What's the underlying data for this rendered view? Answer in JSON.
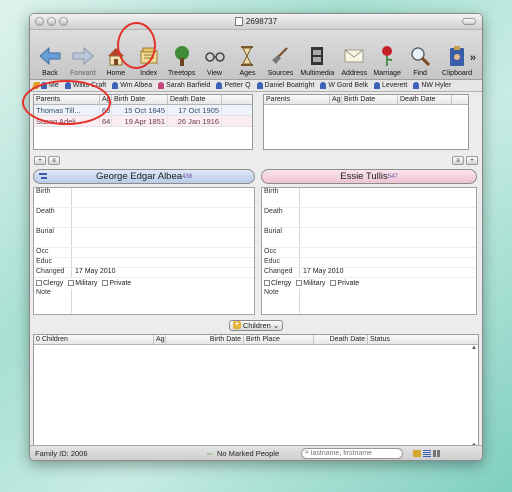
{
  "window": {
    "title": "2698737"
  },
  "toolbar": {
    "buttons": [
      {
        "label": "Back",
        "icon": "back-arrow-icon"
      },
      {
        "label": "Forward",
        "icon": "forward-arrow-icon"
      },
      {
        "label": "Home",
        "icon": "house-icon"
      },
      {
        "label": "Index",
        "icon": "index-card-icon"
      },
      {
        "label": "Treetops",
        "icon": "tree-icon"
      },
      {
        "label": "View",
        "icon": "glasses-icon"
      },
      {
        "label": "Ages",
        "icon": "hourglass-icon"
      },
      {
        "label": "Sources",
        "icon": "shovel-icon"
      },
      {
        "label": "Multimedia",
        "icon": "film-icon"
      },
      {
        "label": "Address",
        "icon": "envelope-icon"
      },
      {
        "label": "Marriage",
        "icon": "rose-icon"
      },
      {
        "label": "Find",
        "icon": "magnifier-icon"
      },
      {
        "label": "Clipboard",
        "icon": "clipboard-icon"
      }
    ],
    "more": "»"
  },
  "favorites": [
    "Me",
    "Willis Craft",
    "Wm Albea",
    "Sarah Barfield",
    "Petter Q",
    "Daniel Boatright",
    "W Gord Belk",
    "Leverett",
    "NW Hyler"
  ],
  "parents_left": {
    "headers": [
      "Parents",
      "Ag",
      "Birth Date",
      "Death Date"
    ],
    "rows": [
      {
        "name": "Thomas Till...",
        "age": "60",
        "birth": "15 Oct 1845",
        "death": "17 Oct 1905",
        "sex": "male"
      },
      {
        "name": "Susan Adeli...",
        "age": "64",
        "birth": "19 Apr 1851",
        "death": "26 Jan 1916",
        "sex": "female"
      }
    ]
  },
  "parents_right": {
    "headers": [
      "Parents",
      "Ag",
      "Birth Date",
      "Death Date"
    ]
  },
  "husband": {
    "name": "George Edgar Albea",
    "id": "438",
    "fields": {
      "birth": "Birth",
      "death": "Death",
      "burial": "Burial",
      "occ": "Occ",
      "educ": "Educ",
      "changed": "Changed",
      "note": "Note"
    },
    "changed_value": "17 May 2010",
    "checks": [
      "Clergy",
      "Military",
      "Private"
    ]
  },
  "wife": {
    "name": "Essie Tullis",
    "id": "547",
    "fields": {
      "birth": "Birth",
      "death": "Death",
      "burial": "Burial",
      "occ": "Occ",
      "educ": "Educ",
      "changed": "Changed",
      "note": "Note"
    },
    "changed_value": "17 May 2010",
    "checks": [
      "Clergy",
      "Military",
      "Private"
    ]
  },
  "children": {
    "button_label": "Children",
    "headers": [
      "0 Children",
      "Ag",
      "Birth Date",
      "Birth Place",
      "Death Date",
      "Status"
    ]
  },
  "status": {
    "family_id": "Family ID: 2006",
    "marked": "No Marked People",
    "search_placeholder": "lastname, firstname"
  }
}
